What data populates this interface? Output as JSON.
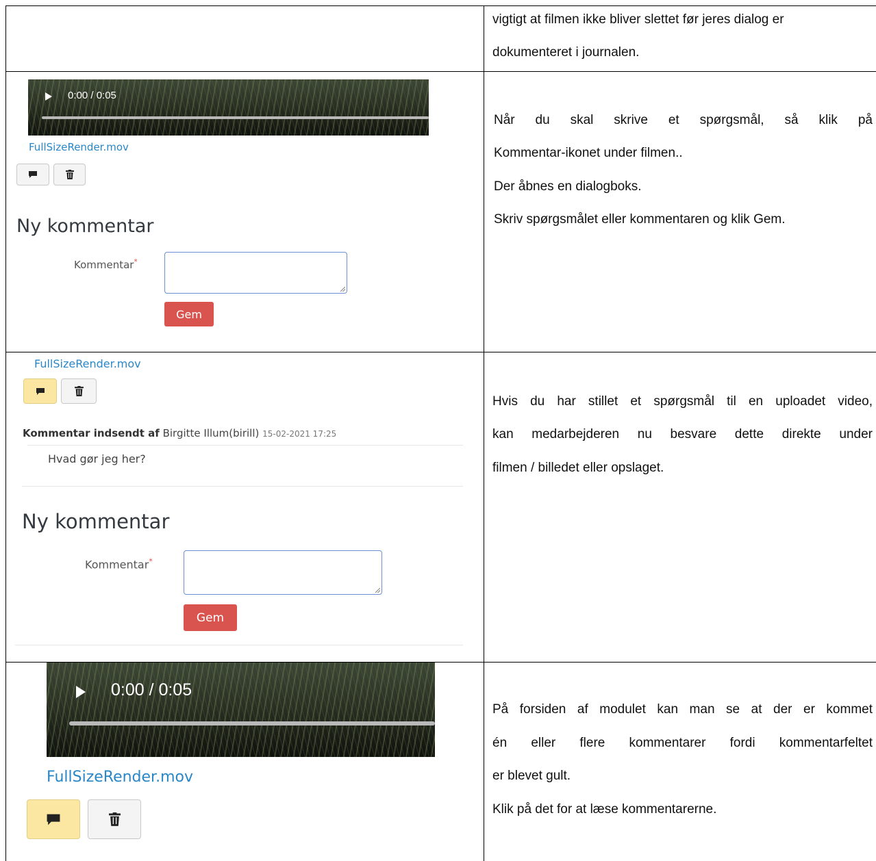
{
  "rows": [
    {
      "right_lines": [
        "vigtigt at filmen ikke bliver slettet før jeres dialog er",
        "dokumenteret i journalen."
      ]
    },
    {
      "video_time": "0:00 / 0:05",
      "file_name": "FullSizeRender.mov",
      "comment_icon": "comment-icon",
      "delete_icon": "trash-icon",
      "new_comment_heading": "Ny kommentar",
      "comment_label": "Kommentar",
      "required_mark": "*",
      "save_label": "Gem",
      "right_lines": [
        "Når du skal skrive et spørgsmål, så klik på",
        "Kommentar-ikonet under filmen..",
        "Der åbnes en dialogboks.",
        "Skriv spørgsmålet eller kommentaren og klik Gem."
      ]
    },
    {
      "file_name": "FullSizeRender.mov",
      "comment_icon": "comment-icon",
      "delete_icon": "trash-icon",
      "comment_by_label": "Kommentar indsendt af",
      "comment_author": "Birgitte Illum(birill)",
      "comment_date": "15-02-2021 17:25",
      "comment_text": "Hvad gør jeg her?",
      "new_comment_heading": "Ny kommentar",
      "comment_label": "Kommentar",
      "required_mark": "*",
      "save_label": "Gem",
      "right_lines": [
        "Hvis du har stillet et spørgsmål til en uploadet video,",
        "kan medarbejderen nu besvare dette direkte under",
        "filmen / billedet eller opslaget."
      ]
    },
    {
      "video_time": "0:00 / 0:05",
      "file_name": "FullSizeRender.mov",
      "comment_icon": "comment-icon",
      "delete_icon": "trash-icon",
      "right_lines": [
        "På forsiden af modulet kan man se at der er kommet",
        "én eller flere kommentarer fordi kommentarfeltet",
        "er blevet gult.",
        "Klik på det for at læse kommentarerne."
      ]
    }
  ],
  "colors": {
    "link": "#2a87c7",
    "save_button": "#d9534f",
    "comment_button_active": "#fbe7a1",
    "required": "#d9534f"
  }
}
